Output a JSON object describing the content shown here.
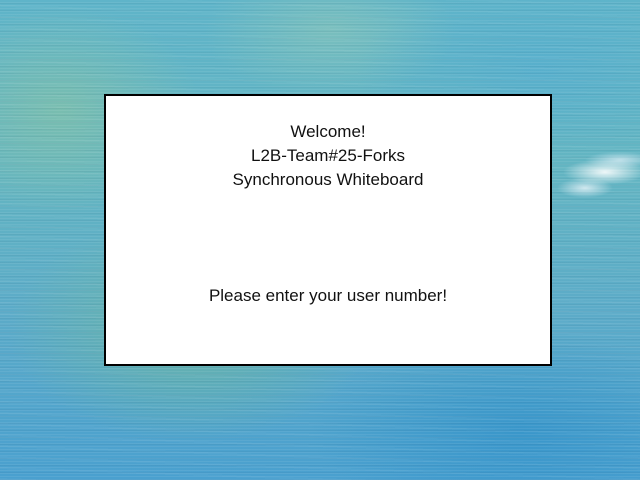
{
  "background": {
    "description_colors": {
      "teal": "#5fb4c9",
      "green": "#78be8c",
      "blue": "#4aa0cf"
    }
  },
  "dialog": {
    "greeting": "Welcome!",
    "team_name": "L2B-Team#25-Forks",
    "app_name": "Synchronous Whiteboard",
    "prompt": "Please enter your user number!"
  }
}
